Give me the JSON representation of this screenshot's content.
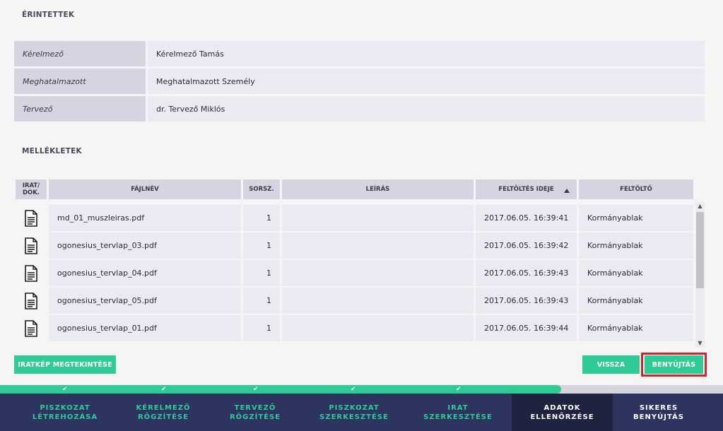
{
  "sections": {
    "erintettek": "ÉRINTETTEK",
    "mellekletek": "MELLÉKLETEK"
  },
  "parties": [
    {
      "label": "Kérelmező",
      "value": "Kérelmező Tamás"
    },
    {
      "label": "Meghatalmazott",
      "value": "Meghatalmazott Személy"
    },
    {
      "label": "Tervező",
      "value": "dr. Tervező Miklós"
    }
  ],
  "table": {
    "headers": {
      "irat": "IRAT/ DOK.",
      "fajlnev": "FÁJLNÉV",
      "sorsz": "SORSZ.",
      "leiras": "LEÍRÁS",
      "feltoltes_ideje": "FELTÖLTÉS IDEJE",
      "feltolto": "FELTÖLTŐ"
    },
    "sort": {
      "column": "feltoltes_ideje",
      "direction": "ascending"
    },
    "rows": [
      {
        "fajlnev": "md_01_muszleiras.pdf",
        "sorsz": "1",
        "leiras": "",
        "ido": "2017.06.05. 16:39:41",
        "feltolto": "Kormányablak"
      },
      {
        "fajlnev": "ogonesius_tervlap_03.pdf",
        "sorsz": "1",
        "leiras": "",
        "ido": "2017.06.05. 16:39:42",
        "feltolto": "Kormányablak"
      },
      {
        "fajlnev": "ogonesius_tervlap_04.pdf",
        "sorsz": "1",
        "leiras": "",
        "ido": "2017.06.05. 16:39:43",
        "feltolto": "Kormányablak"
      },
      {
        "fajlnev": "ogonesius_tervlap_05.pdf",
        "sorsz": "1",
        "leiras": "",
        "ido": "2017.06.05. 16:39:43",
        "feltolto": "Kormányablak"
      },
      {
        "fajlnev": "ogonesius_tervlap_01.pdf",
        "sorsz": "1",
        "leiras": "",
        "ido": "2017.06.05. 16:39:44",
        "feltolto": "Kormányablak"
      }
    ],
    "row_icon": "document-icon"
  },
  "buttons": {
    "iratkep": "IRATKÉP MEGTEKINTÉSE",
    "vissza": "VISSZA",
    "benyujtas": "BENYÚJTÁS"
  },
  "progress": {
    "completed_steps": 5,
    "total_steps": 7,
    "fill_fraction": 0.776
  },
  "steps": [
    {
      "line1": "PISZKOZAT",
      "line2": "LÉTREHOZÁSA",
      "state": "done"
    },
    {
      "line1": "KÉRELMEZŐ",
      "line2": "RÖGZÍTÉSE",
      "state": "done"
    },
    {
      "line1": "TERVEZŐ",
      "line2": "RÖGZÍTÉSE",
      "state": "done"
    },
    {
      "line1": "PISZKOZAT",
      "line2": "SZERKESZTÉSE",
      "state": "done"
    },
    {
      "line1": "IRAT",
      "line2": "SZERKESZTÉSE",
      "state": "done"
    },
    {
      "line1": "ADATOK",
      "line2": "ELLENŐRZÉSE",
      "state": "active"
    },
    {
      "line1": "SIKERES",
      "line2": "BENYÚJTÁS",
      "state": "future"
    }
  ],
  "colors": {
    "accent": "#2fcb95",
    "nav_bg": "#2e3460",
    "nav_active": "#1f2340",
    "highlight": "#d2232a"
  }
}
